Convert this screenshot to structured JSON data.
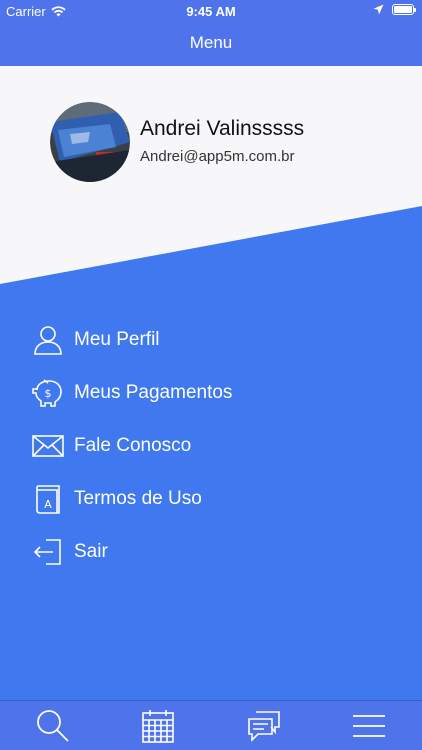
{
  "status_bar": {
    "carrier": "Carrier",
    "time": "9:45 AM"
  },
  "nav": {
    "title": "Menu"
  },
  "profile": {
    "name": "Andrei Valinsssss",
    "email": "Andrei@app5m.com.br"
  },
  "menu": {
    "items": [
      {
        "label": "Meu Perfil",
        "icon": "user-icon"
      },
      {
        "label": "Meus Pagamentos",
        "icon": "piggy-bank-icon"
      },
      {
        "label": "Fale Conosco",
        "icon": "envelope-icon"
      },
      {
        "label": "Termos de Uso",
        "icon": "book-icon"
      },
      {
        "label": "Sair",
        "icon": "logout-icon"
      }
    ]
  },
  "tab_bar": {
    "tabs": [
      {
        "icon": "search-icon"
      },
      {
        "icon": "calendar-icon"
      },
      {
        "icon": "chat-icon"
      },
      {
        "icon": "hamburger-menu-icon"
      }
    ]
  },
  "colors": {
    "primary_blue": "#3f78ef",
    "bar_blue": "#4e73ea",
    "header_white": "#f7f7f9"
  }
}
